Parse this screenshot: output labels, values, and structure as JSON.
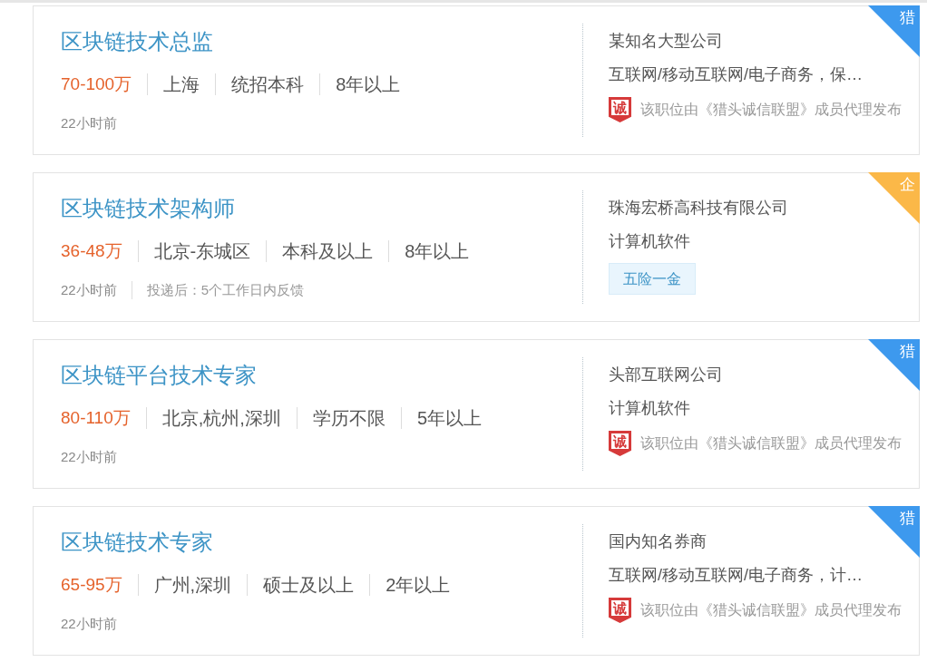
{
  "jobs": [
    {
      "title": "区块链技术总监",
      "salary": "70-100万",
      "requirements": [
        "上海",
        "统招本科",
        "8年以上"
      ],
      "posted": "22小时前",
      "company": "某知名大型公司",
      "industry": "互联网/移动互联网/电子商务，保…",
      "certification": {
        "seal": "诚",
        "text": "该职位由《猎头诚信联盟》成员代理发布"
      },
      "badge": {
        "kind": "headhunter",
        "label": "猎"
      }
    },
    {
      "title": "区块链技术架构师",
      "salary": "36-48万",
      "requirements": [
        "北京-东城区",
        "本科及以上",
        "8年以上"
      ],
      "posted": "22小时前",
      "feedback": "投递后：5个工作日内反馈",
      "company": "珠海宏桥高科技有限公司",
      "industry": "计算机软件",
      "tags": [
        "五险一金"
      ],
      "badge": {
        "kind": "enterprise",
        "label": "企"
      }
    },
    {
      "title": "区块链平台技术专家",
      "salary": "80-110万",
      "requirements": [
        "北京,杭州,深圳",
        "学历不限",
        "5年以上"
      ],
      "posted": "22小时前",
      "company": "头部互联网公司",
      "industry": "计算机软件",
      "certification": {
        "seal": "诚",
        "text": "该职位由《猎头诚信联盟》成员代理发布"
      },
      "badge": {
        "kind": "headhunter",
        "label": "猎"
      }
    },
    {
      "title": "区块链技术专家",
      "salary": "65-95万",
      "requirements": [
        "广州,深圳",
        "硕士及以上",
        "2年以上"
      ],
      "posted": "22小时前",
      "company": "国内知名券商",
      "industry": "互联网/移动互联网/电子商务，计…",
      "certification": {
        "seal": "诚",
        "text": "该职位由《猎头诚信联盟》成员代理发布"
      },
      "badge": {
        "kind": "headhunter",
        "label": "猎"
      }
    }
  ]
}
